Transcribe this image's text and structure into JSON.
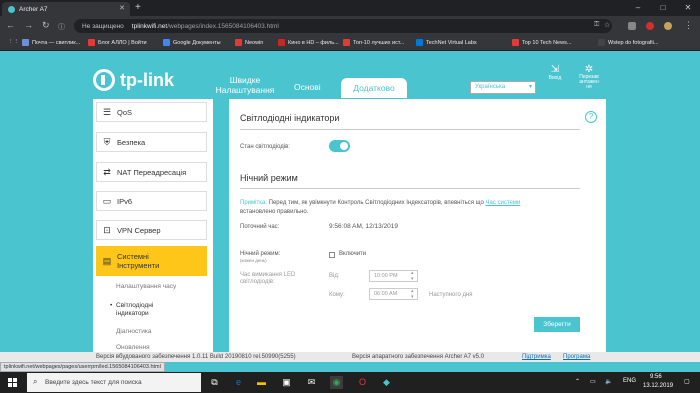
{
  "browser": {
    "tab_title": "Archer A7",
    "new_tab": "+",
    "window_controls": [
      "–",
      "□",
      "✕"
    ],
    "security": "Не защищено",
    "url_host": "tplinkwifi.net",
    "url_path": "/webpages/index.1565084106403.html",
    "bookmarks": [
      {
        "label": "Почта — свитлик...",
        "color": "#6d8fd6"
      },
      {
        "label": "Блог АЛЛО | Войти",
        "color": "#e53935"
      },
      {
        "label": "Google Документы",
        "color": "#4285f4"
      },
      {
        "label": "Neowin",
        "color": "#e53935"
      },
      {
        "label": "Кино в HD – филь...",
        "color": "#c62828"
      },
      {
        "label": "Топ-10 лучших ист...",
        "color": "#e53935"
      },
      {
        "label": "TechNet Virtual Labs",
        "color": "#0078d7"
      },
      {
        "label": "Top 10 Tech News...",
        "color": "#e53935"
      },
      {
        "label": "Wstep do fotografii...",
        "color": "#444"
      }
    ]
  },
  "router": {
    "brand": "tp-link",
    "tabs": {
      "quick": "Швидке\nНалаштування",
      "basic": "Основі",
      "advanced": "Додатково"
    },
    "language": "Українська",
    "logout": "Вихід",
    "reboot": "Перезав\nантажен\nня",
    "menu": [
      {
        "label": "QoS",
        "icon": "☰"
      },
      {
        "label": "Безпека",
        "icon": "⛨"
      },
      {
        "label": "NAT Переадресація",
        "icon": "⇄"
      },
      {
        "label": "IPv6",
        "icon": "▭"
      },
      {
        "label": "VPN Сервер",
        "icon": "⊡"
      },
      {
        "label": "Системні\nІнструменти",
        "icon": "▤"
      }
    ],
    "submenu": [
      "Налаштування часу",
      "Світлодіодні\nіндикатори",
      "Діагностика",
      "Оновлення"
    ],
    "section1_title": "Світлодіодні індикатори",
    "led_status_label": "Стан світлодіодів:",
    "section2_title": "Нічний режим",
    "note_label": "Примітка:",
    "note_text": " Перед тим, як увімкнути Контроль Світлодіодних Індексаторів, впевніться що ",
    "note_link": "Час системи",
    "note_text2": "встановлено правильно.",
    "current_time_label": "Поточний час:",
    "current_time": "9:56:08 AM, 12/13/2019",
    "night_mode_label": "Нічний режим:",
    "night_mode_sub": "(кожен день)",
    "enable_label": "Включити",
    "led_off_time_label": "Час вимикання LED\nсвітлодіодів:",
    "from_label": "Від:",
    "from_value": "10:00 PM",
    "to_label": "Кому:",
    "to_value": "06:00 AM",
    "next_day": "Наступного дня",
    "save": "Зберегти",
    "firmware": "Версія вбудованого забезпечення 1.0.11 Build 20190810 rel.50990(5255)",
    "hardware": "Версія апаратного забезпечення Archer A7 v5.0",
    "support": "Підтримка",
    "app": "Програма"
  },
  "status_url": "tplinkwifi.net/webpages/pages/userrpm/led.1565084106403.html",
  "taskbar": {
    "search_placeholder": "Введите здесь текст для поиска",
    "lang": "ENG",
    "time": "9:56",
    "date": "13.12.2019"
  }
}
